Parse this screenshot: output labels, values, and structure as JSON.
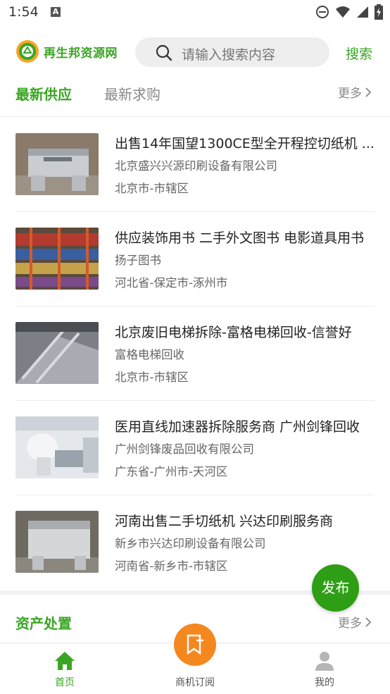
{
  "status_bar": {
    "time": "1:54",
    "notif_letter": "A"
  },
  "header": {
    "logo_text": "再生邦资源网",
    "search_placeholder": "请输入搜索内容",
    "search_button": "搜索"
  },
  "tabs": {
    "active": "最新供应",
    "inactive": "最新求购",
    "more": "更多"
  },
  "items": [
    {
      "title": "出售14年国望1300CE型全开程控切纸机 ...",
      "company": "北京盛兴兴源印刷设备有限公司",
      "location": "北京市-市辖区"
    },
    {
      "title": "供应装饰用书 二手外文图书 电影道具用书",
      "company": "扬子图书",
      "location": "河北省-保定市-涿州市"
    },
    {
      "title": "北京废旧电梯拆除-富格电梯回收-信誉好",
      "company": "富格电梯回收",
      "location": "北京市-市辖区"
    },
    {
      "title": "医用直线加速器拆除服务商 广州剑锋回收",
      "company": "广州剑锋废品回收有限公司",
      "location": "广东省-广州市-天河区"
    },
    {
      "title": "河南出售二手切纸机 兴达印刷服务商",
      "company": "新乡市兴达印刷设备有限公司",
      "location": "河南省-新乡市-市辖区"
    }
  ],
  "section2": {
    "title": "资产处置",
    "more": "更多"
  },
  "fab_label": "发布",
  "bottom_nav": {
    "home": "首页",
    "subscribe": "商机订阅",
    "me": "我的"
  },
  "colors": {
    "accent": "#3aa524",
    "fab": "#2e9e15",
    "orange": "#f5871f"
  }
}
